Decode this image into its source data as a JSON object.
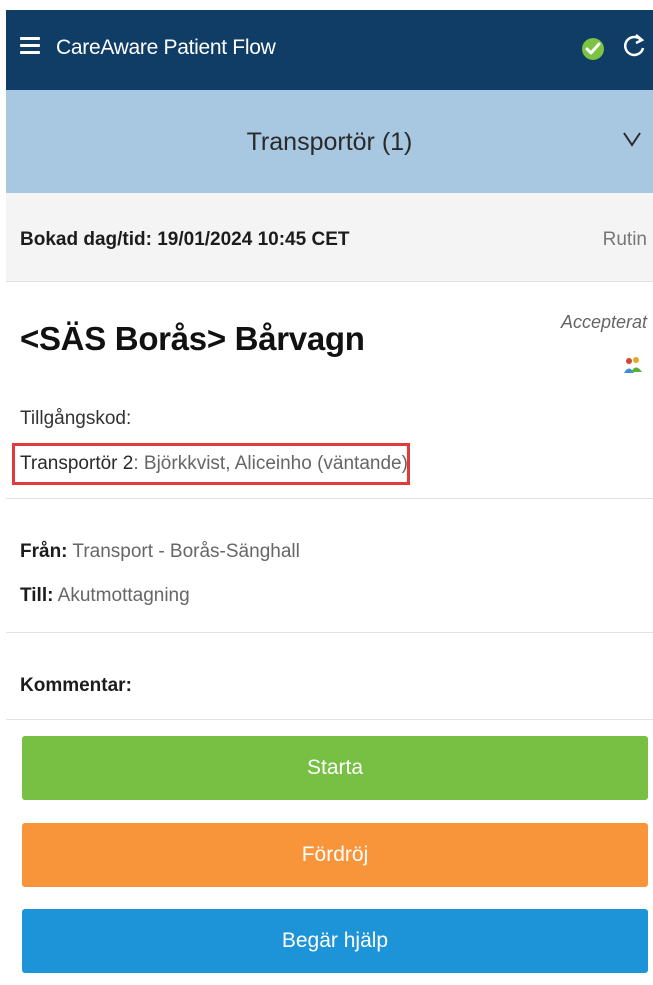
{
  "header": {
    "app_title": "CareAware Patient Flow",
    "status_icon": "check-circle-icon",
    "refresh_icon": "refresh-icon",
    "brand_color": "#0f3d66"
  },
  "section": {
    "title": "Transportör (1)",
    "chevron": "V"
  },
  "booking": {
    "label": "Bokad dag/tid: 19/01/2024 10:45 CET",
    "priority": "Rutin"
  },
  "details": {
    "title": "<SÄS Borås> Bårvagn",
    "status": "Accepterat",
    "access_code_label": "Tillgångskod:",
    "transporter_key": "Transportör 2",
    "transporter_value": ": Björkkvist, Aliceinho (väntande)"
  },
  "route": {
    "from_key": "Från:",
    "from_value": " Transport - Borås-Sänghall",
    "till_key": "Till:",
    "till_value": " Akutmottagning"
  },
  "comment": {
    "label": "Kommentar:"
  },
  "actions": {
    "start_label": "Starta",
    "delay_label": "Fördröj",
    "help_label": "Begär hjälp",
    "start_color": "#77c043",
    "delay_color": "#f8953a",
    "help_color": "#1e94d8"
  }
}
